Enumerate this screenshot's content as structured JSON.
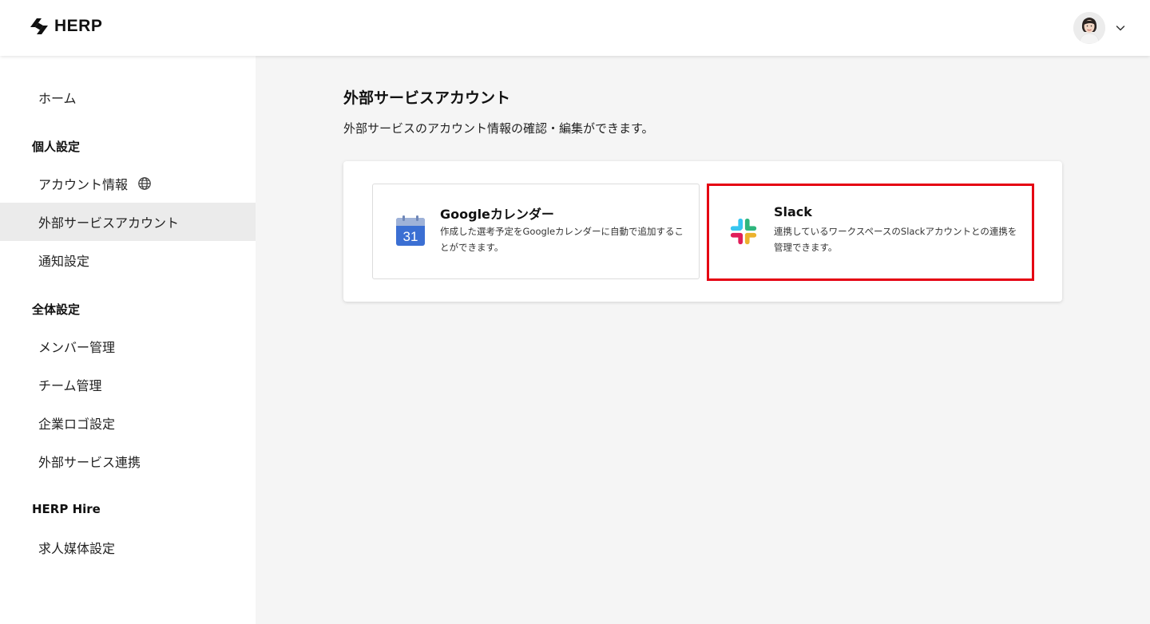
{
  "header": {
    "logo_text": "HERP",
    "icons": {
      "logo": "herp-logo-icon",
      "avatar": "user-avatar",
      "menu": "chevron-down-icon"
    }
  },
  "sidebar": {
    "home": "ホーム",
    "personal_heading": "個人設定",
    "account_info": "アカウント情報",
    "external_accounts": "外部サービスアカウント",
    "notifications": "通知設定",
    "global_heading": "全体設定",
    "members": "メンバー管理",
    "teams": "チーム管理",
    "company_logo": "企業ロゴ設定",
    "external_integration": "外部サービス連携",
    "hire_heading": "HERP Hire",
    "job_media": "求人媒体設定",
    "active_item": "外部サービスアカウント"
  },
  "main": {
    "title": "外部サービスアカウント",
    "description": "外部サービスのアカウント情報の確認・編集ができます。",
    "services": [
      {
        "name": "Googleカレンダー",
        "description": "作成した選考予定をGoogleカレンダーに自動で追加することができます。",
        "icon": "google-calendar-icon",
        "icon_text": "31"
      },
      {
        "name": "Slack",
        "description": "連携しているワークスペースのSlackアカウントとの連携を管理できます。",
        "icon": "slack-icon"
      }
    ]
  },
  "colors": {
    "highlight_border": "#e50012",
    "page_background": "#f5f5f5",
    "active_nav_background": "#ebebeb"
  }
}
